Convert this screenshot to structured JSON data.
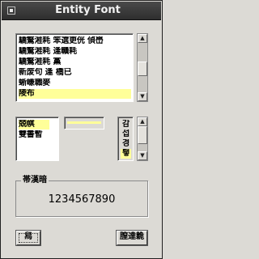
{
  "window": {
    "title": "Entity Font"
  },
  "font_list": {
    "items": [
      "驕驁溎耗 笨選更侊 偵嶨",
      "驕驁溎耗 逢贛耗",
      "驕驁溎耗 黨",
      "新废句 逢 橋已",
      "蜥嵰職麥",
      "陵布"
    ],
    "selected_index": 5
  },
  "style_list": {
    "items": [
      "兢帺",
      "雙書暫"
    ],
    "selected_index": 0
  },
  "size_list": {
    "items": [
      "감",
      "섭",
      "경",
      "퇳"
    ],
    "selected_index": 3
  },
  "sample": {
    "label": "帯漢暗",
    "text": "1234567890"
  },
  "buttons": {
    "ok_label": "舄",
    "cancel_label": "膣達臲"
  },
  "colors": {
    "selection": "#ffff99",
    "titlebar": "#3a3a3a",
    "dialog_bg": "#dcdad5"
  }
}
